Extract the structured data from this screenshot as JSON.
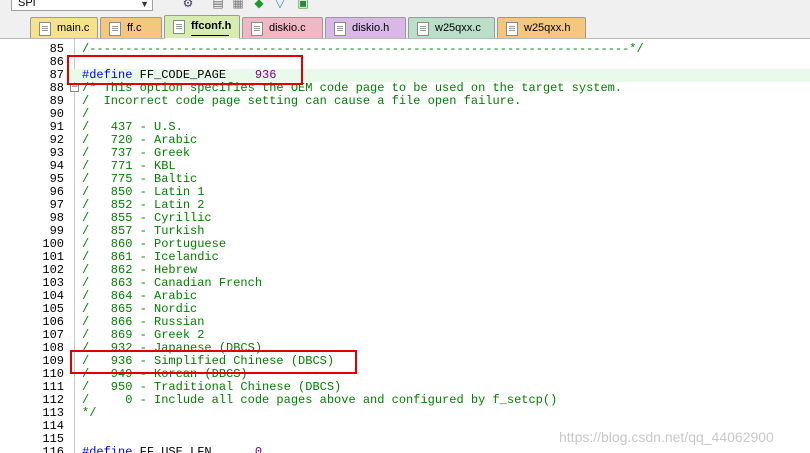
{
  "toolbar": {
    "target_value": "SPI",
    "icons": [
      "target-options-icon",
      "manage-components-icon",
      "download-icon",
      "debug-icon",
      "run-icon"
    ]
  },
  "tabs": [
    {
      "label": "main.c",
      "color": "#f5e28a",
      "active": false
    },
    {
      "label": "ff.c",
      "color": "#f5c77e",
      "active": false
    },
    {
      "label": "ffconf.h",
      "color": "#d6ecb0",
      "active": true
    },
    {
      "label": "diskio.c",
      "color": "#f1b7c4",
      "active": false
    },
    {
      "label": "diskio.h",
      "color": "#d9b8e8",
      "active": false
    },
    {
      "label": "w25qxx.c",
      "color": "#b9dfc9",
      "active": false
    },
    {
      "label": "w25qxx.h",
      "color": "#f5c77e",
      "active": false
    }
  ],
  "editor": {
    "lines": [
      {
        "num": "85",
        "text": "/---------------------------------------------------------------------------*/",
        "style": "comment"
      },
      {
        "num": "86",
        "text": "",
        "style": "plain"
      },
      {
        "num": "87",
        "text": "#define FF_CODE_PAGE    936",
        "style": "define"
      },
      {
        "num": "88",
        "text": "/* This option specifies the OEM code page to be used on the target system.",
        "style": "comment"
      },
      {
        "num": "89",
        "text": "/  Incorrect code page setting can cause a file open failure.",
        "style": "comment"
      },
      {
        "num": "90",
        "text": "/",
        "style": "comment"
      },
      {
        "num": "91",
        "text": "/   437 - U.S.",
        "style": "comment"
      },
      {
        "num": "92",
        "text": "/   720 - Arabic",
        "style": "comment"
      },
      {
        "num": "93",
        "text": "/   737 - Greek",
        "style": "comment"
      },
      {
        "num": "94",
        "text": "/   771 - KBL",
        "style": "comment"
      },
      {
        "num": "95",
        "text": "/   775 - Baltic",
        "style": "comment"
      },
      {
        "num": "96",
        "text": "/   850 - Latin 1",
        "style": "comment"
      },
      {
        "num": "97",
        "text": "/   852 - Latin 2",
        "style": "comment"
      },
      {
        "num": "98",
        "text": "/   855 - Cyrillic",
        "style": "comment"
      },
      {
        "num": "99",
        "text": "/   857 - Turkish",
        "style": "comment"
      },
      {
        "num": "100",
        "text": "/   860 - Portuguese",
        "style": "comment"
      },
      {
        "num": "101",
        "text": "/   861 - Icelandic",
        "style": "comment"
      },
      {
        "num": "102",
        "text": "/   862 - Hebrew",
        "style": "comment"
      },
      {
        "num": "103",
        "text": "/   863 - Canadian French",
        "style": "comment"
      },
      {
        "num": "104",
        "text": "/   864 - Arabic",
        "style": "comment"
      },
      {
        "num": "105",
        "text": "/   865 - Nordic",
        "style": "comment"
      },
      {
        "num": "106",
        "text": "/   866 - Russian",
        "style": "comment"
      },
      {
        "num": "107",
        "text": "/   869 - Greek 2",
        "style": "comment"
      },
      {
        "num": "108",
        "text": "/   932 - Japanese (DBCS)",
        "style": "comment"
      },
      {
        "num": "109",
        "text": "/   936 - Simplified Chinese (DBCS)",
        "style": "comment"
      },
      {
        "num": "110",
        "text": "/   949 - Korean (DBCS)",
        "style": "comment"
      },
      {
        "num": "111",
        "text": "/   950 - Traditional Chinese (DBCS)",
        "style": "comment"
      },
      {
        "num": "112",
        "text": "/     0 - Include all code pages above and configured by f_setcp()",
        "style": "comment"
      },
      {
        "num": "113",
        "text": "*/",
        "style": "comment"
      },
      {
        "num": "114",
        "text": "",
        "style": "plain"
      },
      {
        "num": "115",
        "text": "",
        "style": "plain"
      },
      {
        "num": "116",
        "text": "#define FF_USE_LFN      0",
        "style": "define"
      }
    ]
  },
  "watermark": "https://blog.csdn.net/qq_44062900",
  "colors": {
    "comment": "#008000",
    "preprocessor": "#0000ff",
    "number": "#800080",
    "current_line": "#eafaea",
    "annotation": "#e00000"
  }
}
